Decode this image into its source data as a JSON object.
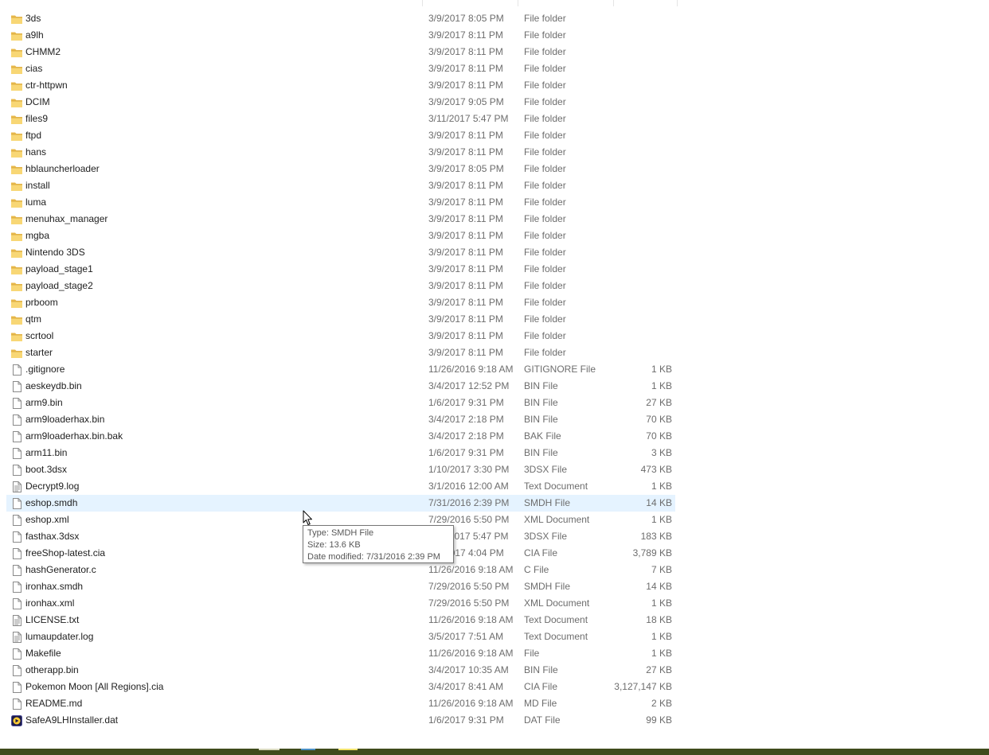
{
  "files": [
    {
      "name": "3ds",
      "date": "3/9/2017 8:05 PM",
      "type": "File folder",
      "size": "",
      "icon": "folder-icon"
    },
    {
      "name": "a9lh",
      "date": "3/9/2017 8:11 PM",
      "type": "File folder",
      "size": "",
      "icon": "folder-icon"
    },
    {
      "name": "CHMM2",
      "date": "3/9/2017 8:11 PM",
      "type": "File folder",
      "size": "",
      "icon": "folder-icon"
    },
    {
      "name": "cias",
      "date": "3/9/2017 8:11 PM",
      "type": "File folder",
      "size": "",
      "icon": "folder-icon"
    },
    {
      "name": "ctr-httpwn",
      "date": "3/9/2017 8:11 PM",
      "type": "File folder",
      "size": "",
      "icon": "folder-icon"
    },
    {
      "name": "DCIM",
      "date": "3/9/2017 9:05 PM",
      "type": "File folder",
      "size": "",
      "icon": "folder-icon"
    },
    {
      "name": "files9",
      "date": "3/11/2017 5:47 PM",
      "type": "File folder",
      "size": "",
      "icon": "folder-icon"
    },
    {
      "name": "ftpd",
      "date": "3/9/2017 8:11 PM",
      "type": "File folder",
      "size": "",
      "icon": "folder-icon"
    },
    {
      "name": "hans",
      "date": "3/9/2017 8:11 PM",
      "type": "File folder",
      "size": "",
      "icon": "folder-icon"
    },
    {
      "name": "hblauncherloader",
      "date": "3/9/2017 8:05 PM",
      "type": "File folder",
      "size": "",
      "icon": "folder-icon"
    },
    {
      "name": "install",
      "date": "3/9/2017 8:11 PM",
      "type": "File folder",
      "size": "",
      "icon": "folder-icon"
    },
    {
      "name": "luma",
      "date": "3/9/2017 8:11 PM",
      "type": "File folder",
      "size": "",
      "icon": "folder-icon"
    },
    {
      "name": "menuhax_manager",
      "date": "3/9/2017 8:11 PM",
      "type": "File folder",
      "size": "",
      "icon": "folder-icon"
    },
    {
      "name": "mgba",
      "date": "3/9/2017 8:11 PM",
      "type": "File folder",
      "size": "",
      "icon": "folder-icon"
    },
    {
      "name": "Nintendo 3DS",
      "date": "3/9/2017 8:11 PM",
      "type": "File folder",
      "size": "",
      "icon": "folder-icon"
    },
    {
      "name": "payload_stage1",
      "date": "3/9/2017 8:11 PM",
      "type": "File folder",
      "size": "",
      "icon": "folder-icon"
    },
    {
      "name": "payload_stage2",
      "date": "3/9/2017 8:11 PM",
      "type": "File folder",
      "size": "",
      "icon": "folder-icon"
    },
    {
      "name": "prboom",
      "date": "3/9/2017 8:11 PM",
      "type": "File folder",
      "size": "",
      "icon": "folder-icon"
    },
    {
      "name": "qtm",
      "date": "3/9/2017 8:11 PM",
      "type": "File folder",
      "size": "",
      "icon": "folder-icon"
    },
    {
      "name": "scrtool",
      "date": "3/9/2017 8:11 PM",
      "type": "File folder",
      "size": "",
      "icon": "folder-icon"
    },
    {
      "name": "starter",
      "date": "3/9/2017 8:11 PM",
      "type": "File folder",
      "size": "",
      "icon": "folder-icon"
    },
    {
      "name": ".gitignore",
      "date": "11/26/2016 9:18 AM",
      "type": "GITIGNORE File",
      "size": "1 KB",
      "icon": "file-icon"
    },
    {
      "name": "aeskeydb.bin",
      "date": "3/4/2017 12:52 PM",
      "type": "BIN File",
      "size": "1 KB",
      "icon": "file-icon"
    },
    {
      "name": "arm9.bin",
      "date": "1/6/2017 9:31 PM",
      "type": "BIN File",
      "size": "27 KB",
      "icon": "file-icon"
    },
    {
      "name": "arm9loaderhax.bin",
      "date": "3/4/2017 2:18 PM",
      "type": "BIN File",
      "size": "70 KB",
      "icon": "file-icon"
    },
    {
      "name": "arm9loaderhax.bin.bak",
      "date": "3/4/2017 2:18 PM",
      "type": "BAK File",
      "size": "70 KB",
      "icon": "file-icon"
    },
    {
      "name": "arm11.bin",
      "date": "1/6/2017 9:31 PM",
      "type": "BIN File",
      "size": "3 KB",
      "icon": "file-icon"
    },
    {
      "name": "boot.3dsx",
      "date": "1/10/2017 3:30 PM",
      "type": "3DSX File",
      "size": "473 KB",
      "icon": "file-icon"
    },
    {
      "name": "Decrypt9.log",
      "date": "3/1/2016 12:00 AM",
      "type": "Text Document",
      "size": "1 KB",
      "icon": "text-document-icon"
    },
    {
      "name": "eshop.smdh",
      "date": "7/31/2016 2:39 PM",
      "type": "SMDH File",
      "size": "14 KB",
      "icon": "file-icon",
      "hover": true
    },
    {
      "name": "eshop.xml",
      "date": "7/29/2016 5:50 PM",
      "type": "XML Document",
      "size": "1 KB",
      "icon": "file-icon"
    },
    {
      "name": "fasthax.3dsx",
      "date": "3/11/2017 5:47 PM",
      "type": "3DSX File",
      "size": "183 KB",
      "icon": "file-icon"
    },
    {
      "name": "freeShop-latest.cia",
      "date": "3/9/2017 4:04 PM",
      "type": "CIA File",
      "size": "3,789 KB",
      "icon": "file-icon"
    },
    {
      "name": "hashGenerator.c",
      "date": "11/26/2016 9:18 AM",
      "type": "C File",
      "size": "7 KB",
      "icon": "file-icon"
    },
    {
      "name": "ironhax.smdh",
      "date": "7/29/2016 5:50 PM",
      "type": "SMDH File",
      "size": "14 KB",
      "icon": "file-icon"
    },
    {
      "name": "ironhax.xml",
      "date": "7/29/2016 5:50 PM",
      "type": "XML Document",
      "size": "1 KB",
      "icon": "file-icon"
    },
    {
      "name": "LICENSE.txt",
      "date": "11/26/2016 9:18 AM",
      "type": "Text Document",
      "size": "18 KB",
      "icon": "text-document-icon"
    },
    {
      "name": "lumaupdater.log",
      "date": "3/5/2017 7:51 AM",
      "type": "Text Document",
      "size": "1 KB",
      "icon": "text-document-icon"
    },
    {
      "name": "Makefile",
      "date": "11/26/2016 9:18 AM",
      "type": "File",
      "size": "1 KB",
      "icon": "file-icon"
    },
    {
      "name": "otherapp.bin",
      "date": "3/4/2017 10:35 AM",
      "type": "BIN File",
      "size": "27 KB",
      "icon": "file-icon"
    },
    {
      "name": "Pokemon Moon [All Regions].cia",
      "date": "3/4/2017 8:41 AM",
      "type": "CIA File",
      "size": "3,127,147 KB",
      "icon": "file-icon"
    },
    {
      "name": "README.md",
      "date": "11/26/2016 9:18 AM",
      "type": "MD File",
      "size": "2 KB",
      "icon": "file-icon"
    },
    {
      "name": "SafeA9LHInstaller.dat",
      "date": "1/6/2017 9:31 PM",
      "type": "DAT File",
      "size": "99 KB",
      "icon": "media-file-icon"
    }
  ],
  "tooltip": {
    "type_line": "Type: SMDH File",
    "size_line": "Size: 13.6 KB",
    "date_line": "Date modified: 7/31/2016 2:39 PM"
  },
  "colors": {
    "folder": "#f8d775",
    "hover_row": "#e5f3ff",
    "taskbar": "#3f4b1c"
  }
}
